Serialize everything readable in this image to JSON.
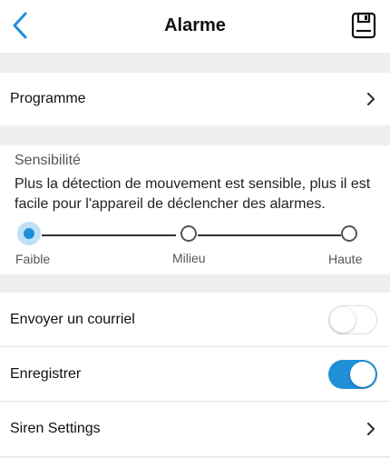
{
  "header": {
    "title": "Alarme",
    "back_icon": "chevron-left-icon",
    "save_icon": "floppy-disk-icon"
  },
  "schedule": {
    "label": "Programme"
  },
  "sensitivity": {
    "title": "Sensibilité",
    "description": "Plus la détection de mouvement est sensible, plus il est facile pour l'appareil de déclencher des alarmes.",
    "levels": [
      "Faible",
      "Milieu",
      "Haute"
    ],
    "selected": "Faible"
  },
  "email": {
    "label": "Envoyer un courriel",
    "enabled": false
  },
  "record": {
    "label": "Enregistrer",
    "enabled": true
  },
  "siren": {
    "label": "Siren Settings"
  },
  "colors": {
    "accent": "#1f8fd8",
    "background": "#f1f1f1"
  }
}
